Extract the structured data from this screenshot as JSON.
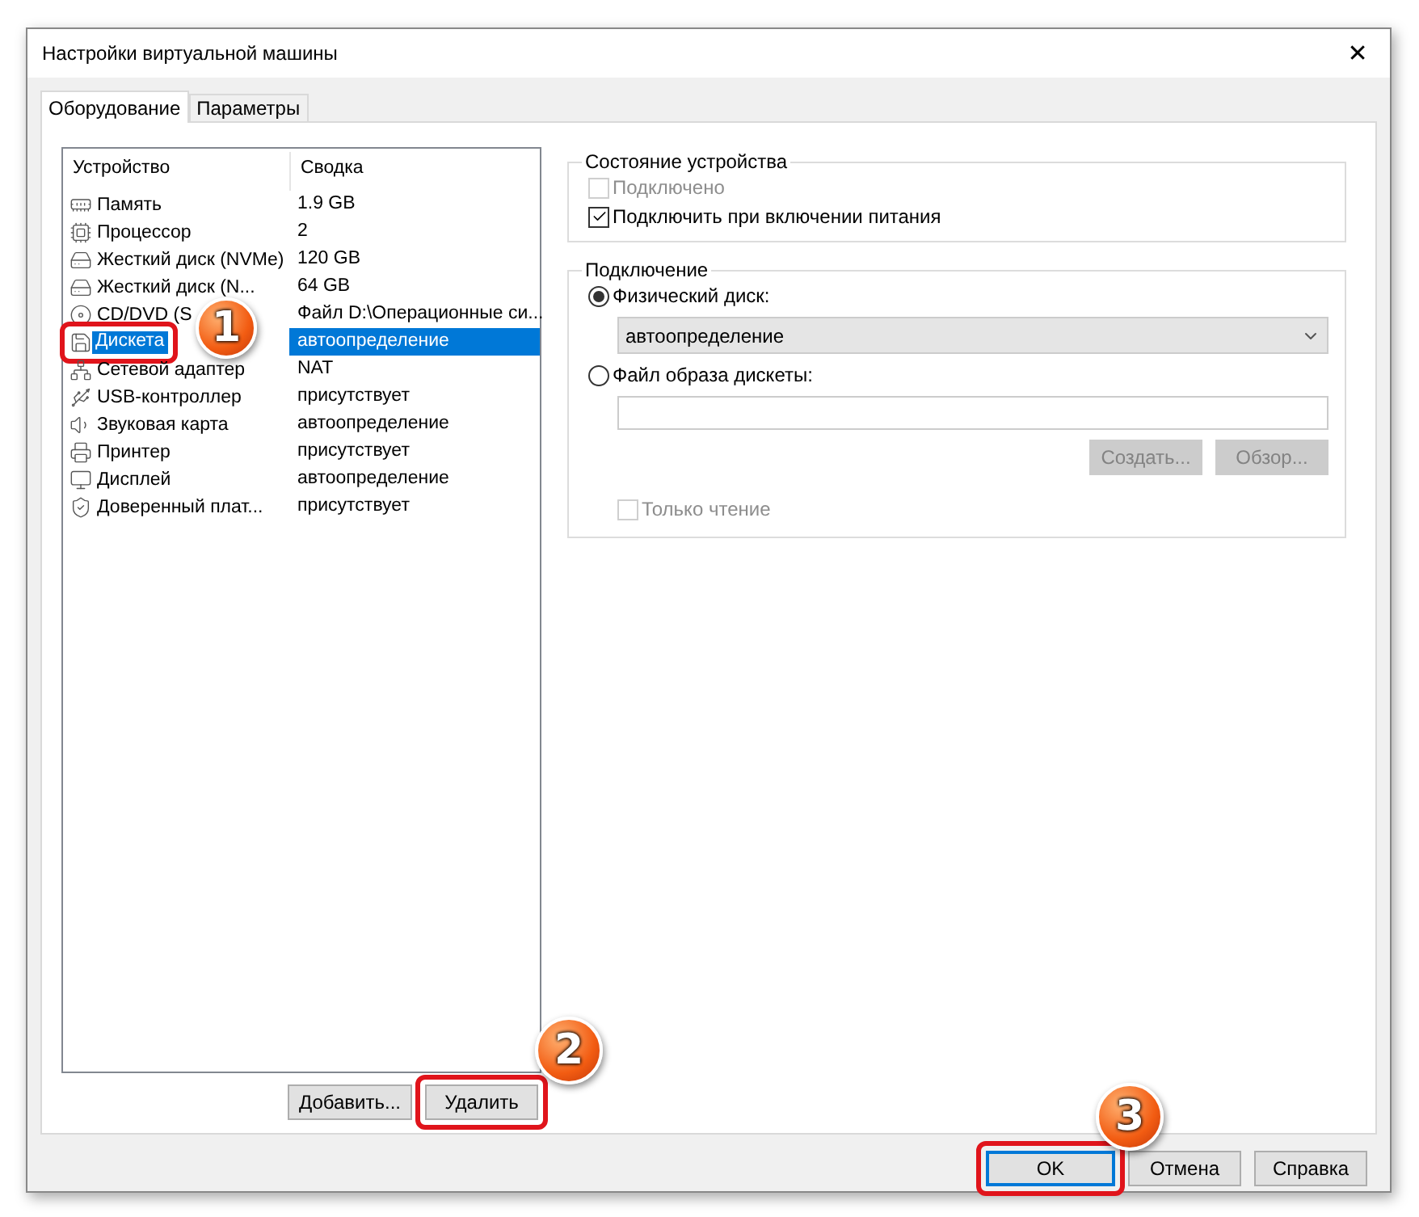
{
  "window": {
    "title": "Настройки виртуальной машины",
    "close": "✕"
  },
  "tabs": [
    {
      "label": "Оборудование",
      "selected": true
    },
    {
      "label": "Параметры",
      "selected": false
    }
  ],
  "devices": {
    "columns": [
      "Устройство",
      "Сводка"
    ],
    "rows": [
      {
        "name": "Память",
        "summary": "1.9 GB",
        "selected": false
      },
      {
        "name": "Процессор",
        "summary": "2",
        "selected": false
      },
      {
        "name": "Жесткий диск (NVMe)",
        "summary": "120 GB",
        "selected": false
      },
      {
        "name": "Жесткий диск (N...",
        "summary": "64 GB",
        "selected": false
      },
      {
        "name": "CD/DVD (S",
        "summary": "Файл D:\\Операционные си...",
        "selected": false
      },
      {
        "name": "Дискета",
        "summary": "автоопределение",
        "selected": true,
        "callout": "1"
      },
      {
        "name": "Сетевой адаптер",
        "summary": "NAT",
        "selected": false
      },
      {
        "name": "USB-контроллер",
        "summary": "присутствует",
        "selected": false
      },
      {
        "name": "Звуковая карта",
        "summary": "автоопределение",
        "selected": false
      },
      {
        "name": "Принтер",
        "summary": "присутствует",
        "selected": false
      },
      {
        "name": "Дисплей",
        "summary": "автоопределение",
        "selected": false
      },
      {
        "name": "Доверенный плат...",
        "summary": "присутствует",
        "selected": false
      }
    ],
    "buttons": [
      {
        "label": "Добавить..."
      },
      {
        "label": "Удалить",
        "callout": "2"
      }
    ]
  },
  "device_status": {
    "title": "Состояние устройства",
    "checkboxes": [
      {
        "label": "Подключено",
        "checked": false,
        "disabled": true
      },
      {
        "label": "Подключить при включении питания",
        "checked": true,
        "disabled": false
      }
    ]
  },
  "connection": {
    "title": "Подключение",
    "physical": {
      "label": "Физический диск:",
      "selected": true,
      "value": "автоопределение"
    },
    "image": {
      "label": "Файл образа дискеты:",
      "selected": false
    },
    "buttons": [
      {
        "label": "Создать...",
        "disabled": true
      },
      {
        "label": "Обзор...",
        "disabled": true
      }
    ],
    "readonly": {
      "label": "Только чтение",
      "checked": false,
      "disabled": true
    }
  },
  "footer": [
    {
      "label": "OK",
      "default": true,
      "callout": "3"
    },
    {
      "label": "Отмена",
      "default": false
    },
    {
      "label": "Справка",
      "default": false
    }
  ]
}
